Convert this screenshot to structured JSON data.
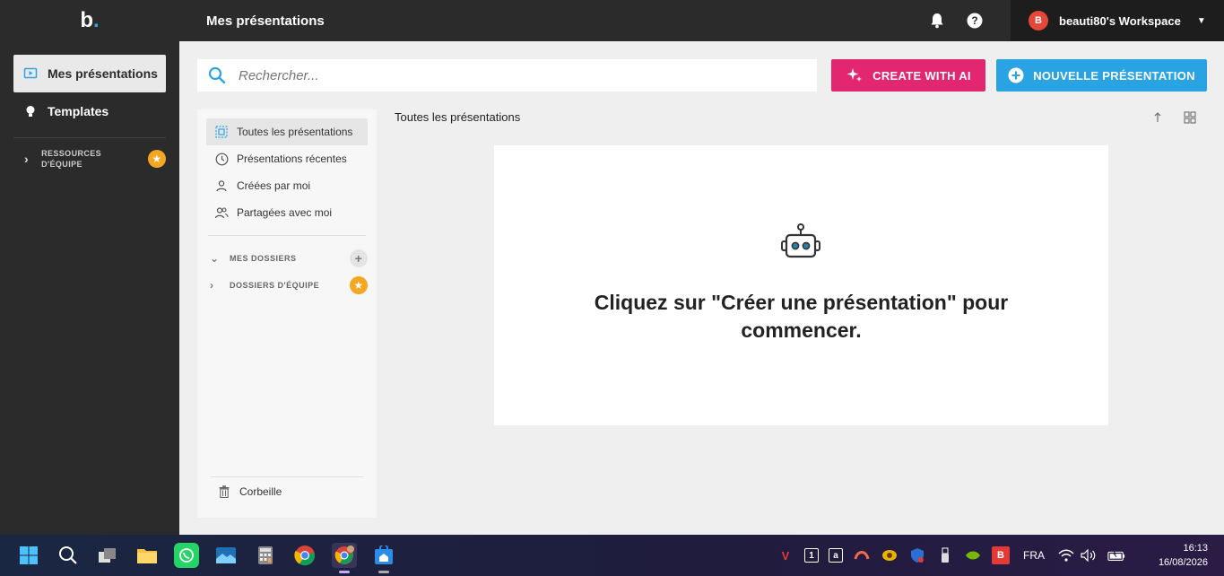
{
  "app": {
    "logo_text": "b",
    "logo_dot": "."
  },
  "sidebar": {
    "items": [
      {
        "label": "Mes présentations",
        "icon": "presentation-icon",
        "active": true
      },
      {
        "label": "Templates",
        "icon": "lightbulb-icon",
        "active": false
      }
    ],
    "team_resources": {
      "line1": "RESSOURCES",
      "line2": "D'ÉQUIPE",
      "badge_icon": "star-icon"
    }
  },
  "header": {
    "title": "Mes présentations",
    "notification_icon": "bell-icon",
    "help_icon": "help-icon",
    "workspace": {
      "avatar_letter": "B",
      "name": "beauti80's Workspace",
      "caret": "▼"
    }
  },
  "search": {
    "placeholder": "Rechercher..."
  },
  "actions": {
    "create_ai_label": "CREATE WITH AI",
    "new_presentation_label": "NOUVELLE PRÉSENTATION"
  },
  "filters": {
    "items": [
      {
        "label": "Toutes les présentations",
        "icon": "all-presentations-icon",
        "active": true
      },
      {
        "label": "Présentations récentes",
        "icon": "clock-icon",
        "active": false
      },
      {
        "label": "Créées par moi",
        "icon": "user-icon",
        "active": false
      },
      {
        "label": "Partagées avec moi",
        "icon": "users-icon",
        "active": false
      }
    ],
    "my_folders_label": "MES DOSSIERS",
    "team_folders_label": "DOSSIERS D'ÉQUIPE",
    "trash_label": "Corbeille"
  },
  "content": {
    "title": "Toutes les présentations",
    "empty_message": "Cliquez sur \"Créer une présentation\" pour commencer."
  },
  "taskbar": {
    "language": "FRA",
    "time": "16:13",
    "date": "16/08/2026"
  },
  "colors": {
    "sidebar_bg": "#2b2b2b",
    "ai_button": "#e2266f",
    "new_button": "#29a3e1",
    "avatar": "#e5473a",
    "star_badge": "#f5a623"
  }
}
